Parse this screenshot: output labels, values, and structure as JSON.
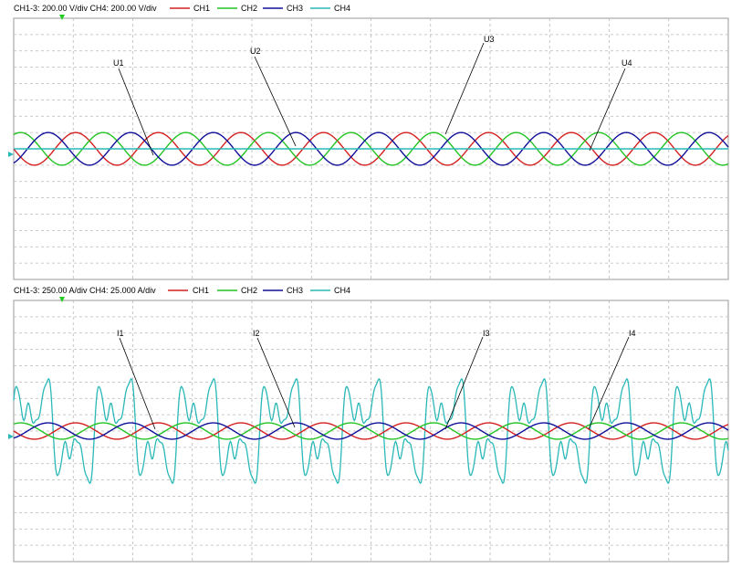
{
  "colors": {
    "ch1": "#d42020",
    "ch2": "#22c422",
    "ch3": "#10109a",
    "ch4": "#2ab8b8",
    "grid": "#b8b8b8",
    "marker": "#22cc22"
  },
  "voltage_panel": {
    "scale_text": "CH1-3: 200.00 V/div  CH4: 200.00 V/div",
    "legend": [
      {
        "key": "ch1",
        "label": "CH1"
      },
      {
        "key": "ch2",
        "label": "CH2"
      },
      {
        "key": "ch3",
        "label": "CH3"
      },
      {
        "key": "ch4",
        "label": "CH4"
      }
    ],
    "labels": [
      "U1",
      "U2",
      "U3",
      "U4"
    ]
  },
  "current_panel": {
    "scale_text": "CH1-3: 250.00 A/div  CH4: 25.000 A/div",
    "legend": [
      {
        "key": "ch1",
        "label": "CH1"
      },
      {
        "key": "ch2",
        "label": "CH2"
      },
      {
        "key": "ch3",
        "label": "CH3"
      },
      {
        "key": "ch4",
        "label": "CH4"
      }
    ],
    "labels": [
      "I1",
      "I2",
      "I3",
      "I4"
    ]
  },
  "chart_data": [
    {
      "type": "line",
      "name": "voltage",
      "grid": {
        "x_divisions": 12,
        "y_divisions": 16
      },
      "cycles": 8.65,
      "series": [
        {
          "name": "CH1",
          "label": "U1",
          "waveform": "sine",
          "amplitude_div": 1.0,
          "phase_deg": 180
        },
        {
          "name": "CH2",
          "label": "U2",
          "waveform": "sine",
          "amplitude_div": 1.0,
          "phase_deg": 60
        },
        {
          "name": "CH3",
          "label": "U3",
          "waveform": "sine",
          "amplitude_div": 1.0,
          "phase_deg": -60
        },
        {
          "name": "CH4",
          "label": "U4",
          "waveform": "dc",
          "amplitude_div": 0
        }
      ]
    },
    {
      "type": "line",
      "name": "current",
      "grid": {
        "x_divisions": 12,
        "y_divisions": 16
      },
      "cycles": 8.65,
      "series": [
        {
          "name": "CH1",
          "label": "I1",
          "waveform": "sine",
          "amplitude_div": 0.5,
          "phase_deg": 180
        },
        {
          "name": "CH2",
          "label": "I2",
          "waveform": "sine",
          "amplitude_div": 0.5,
          "phase_deg": 60
        },
        {
          "name": "CH3",
          "label": "I3",
          "waveform": "sine",
          "amplitude_div": 0.5,
          "phase_deg": -60
        },
        {
          "name": "CH4",
          "label": "I4",
          "waveform": "distorted",
          "amplitude_div": 3.2,
          "phase_deg": 0
        }
      ]
    }
  ]
}
